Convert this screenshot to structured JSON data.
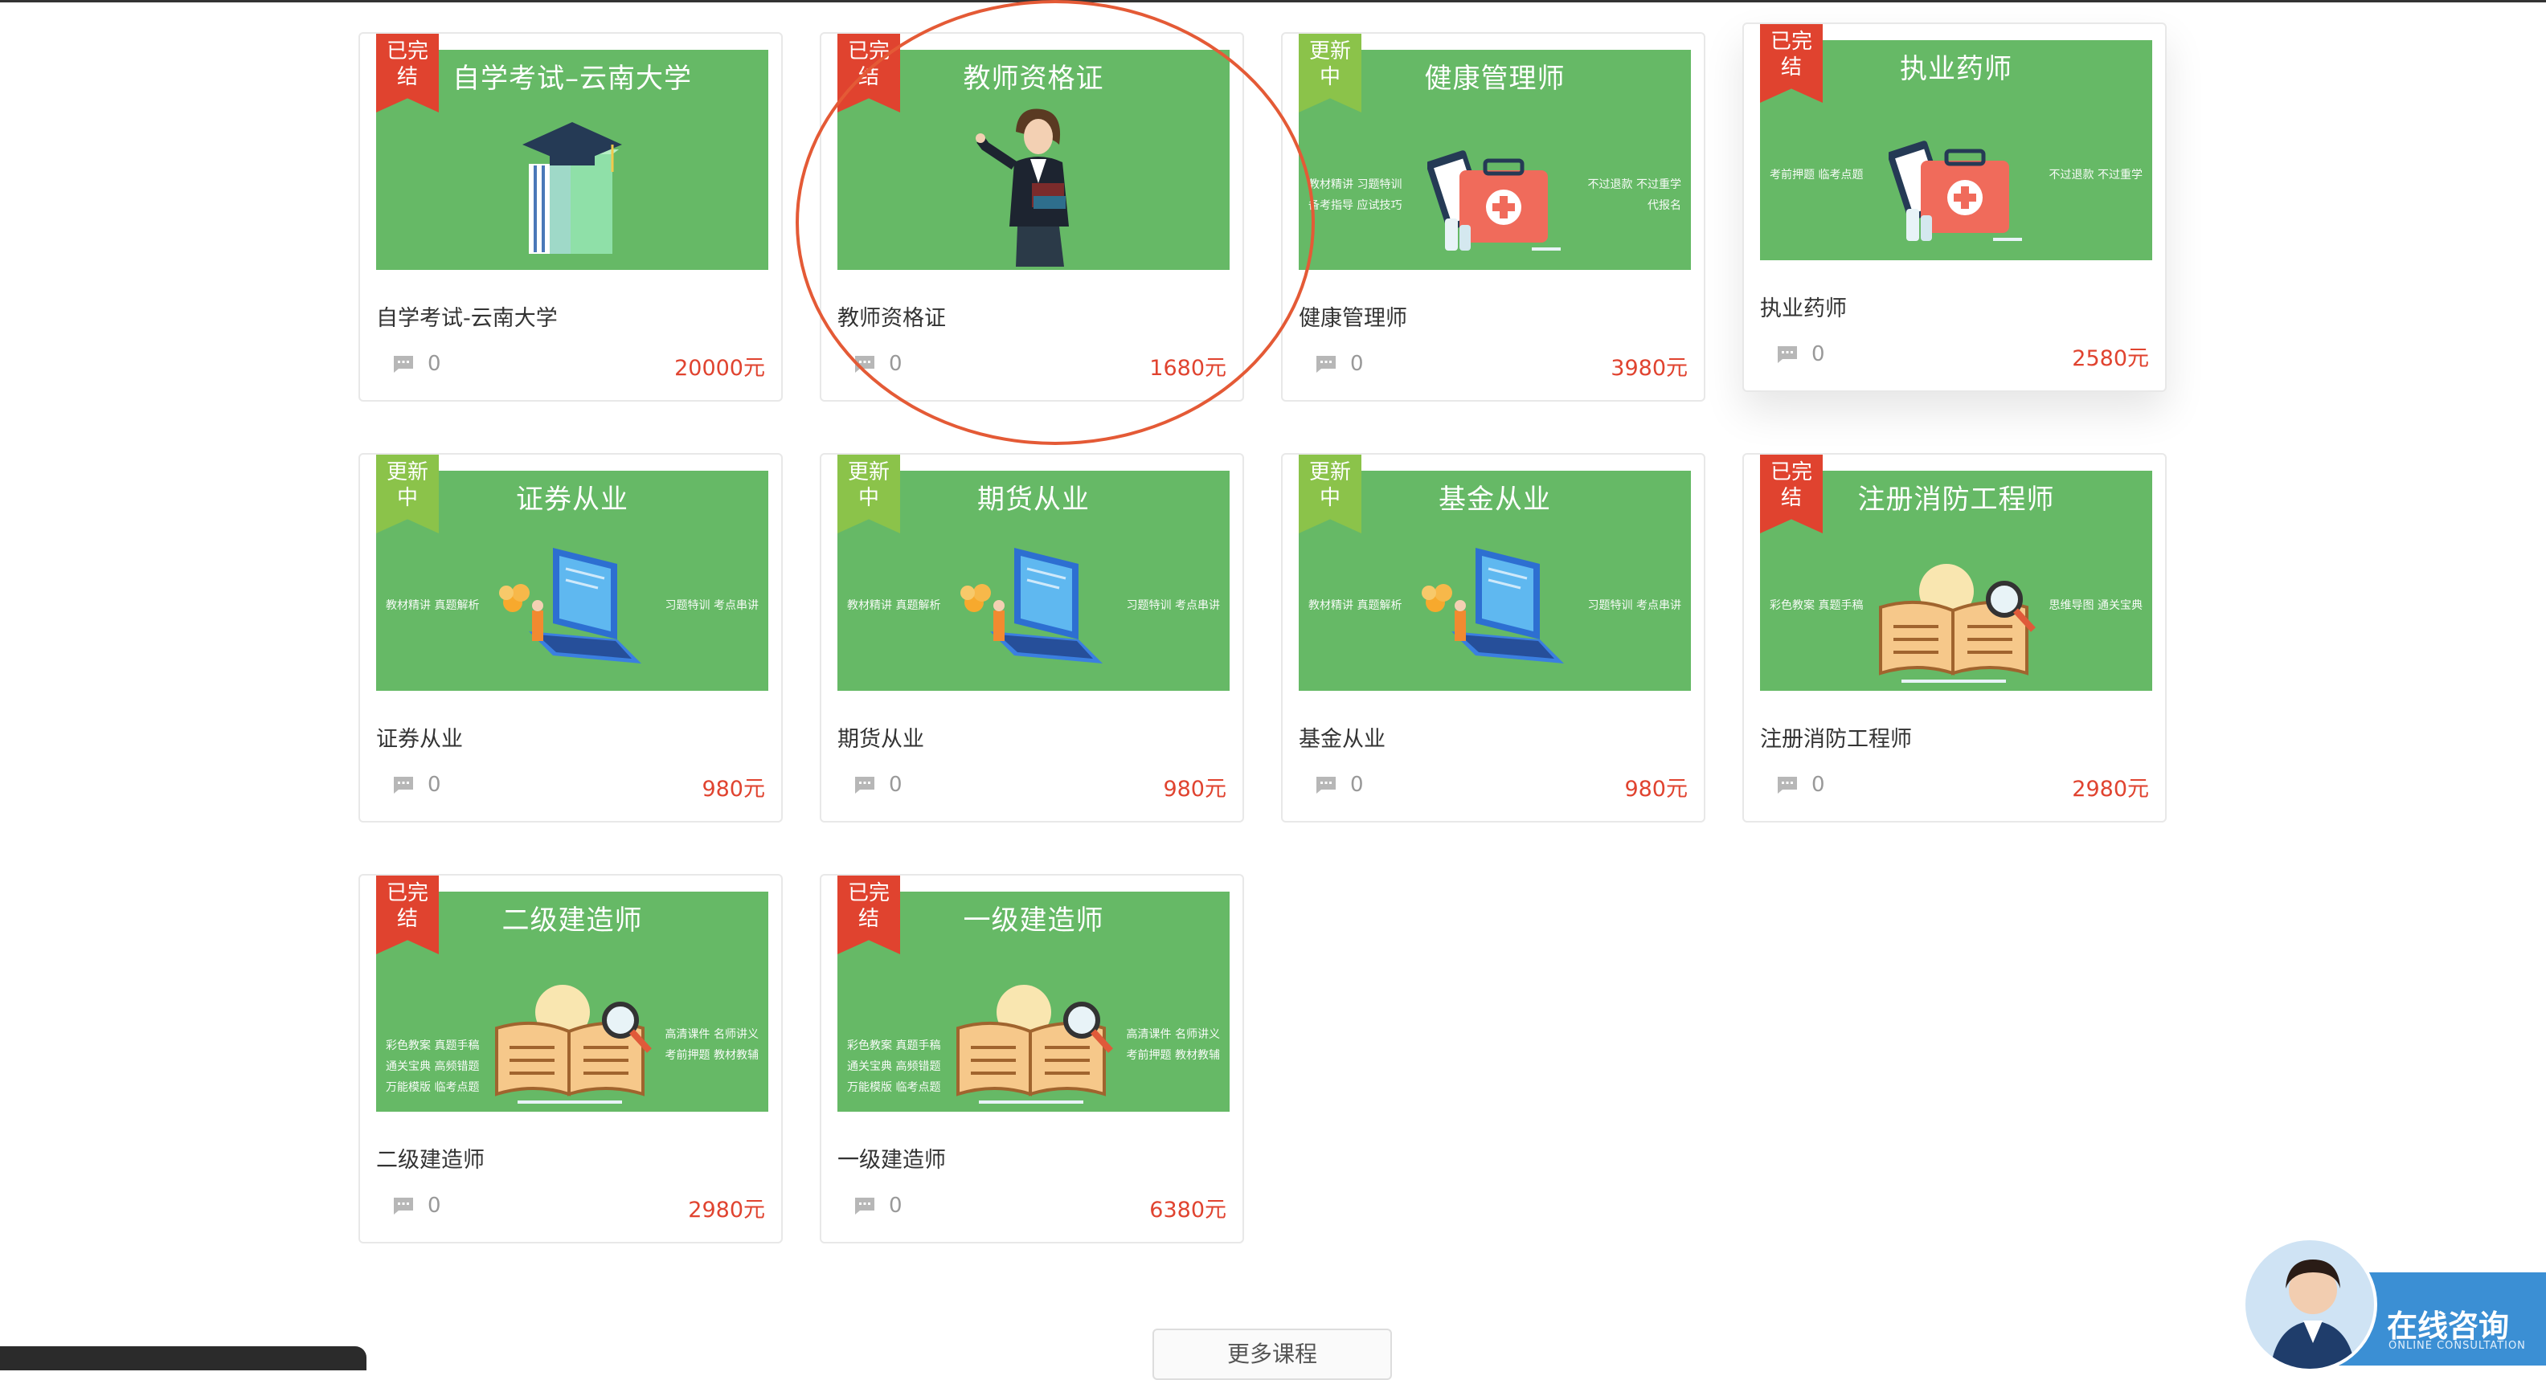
{
  "courses": [
    {
      "thumb_title": "自学考试–云南大学",
      "ribbon": "已完\n结",
      "ribbon_type": "done",
      "name": "自学考试-云南大学",
      "comments": "0",
      "price": "20000元",
      "illus": "books-cap",
      "feat_left": [],
      "feat_right": []
    },
    {
      "thumb_title": "教师资格证",
      "ribbon": "已完\n结",
      "ribbon_type": "done",
      "name": "教师资格证",
      "comments": "0",
      "price": "1680元",
      "illus": "teacher",
      "feat_left": [],
      "feat_right": []
    },
    {
      "thumb_title": "健康管理师",
      "ribbon": "更新\n中",
      "ribbon_type": "updating",
      "name": "健康管理师",
      "comments": "0",
      "price": "3980元",
      "illus": "medkit",
      "feat_left": [
        "教材精讲  习题特训",
        "备考指导  应试技巧"
      ],
      "feat_right": [
        "不过退款  不过重学",
        "代报名"
      ]
    },
    {
      "thumb_title": "执业药师",
      "ribbon": "已完\n结",
      "ribbon_type": "done",
      "name": "执业药师",
      "comments": "0",
      "price": "2580元",
      "illus": "medkit",
      "feat_left": [
        "考前押题  临考点题"
      ],
      "feat_right": [
        "不过退款  不过重学"
      ]
    },
    {
      "thumb_title": "证券从业",
      "ribbon": "更新\n中",
      "ribbon_type": "updating",
      "name": "证券从业",
      "comments": "0",
      "price": "980元",
      "illus": "laptop",
      "feat_left": [
        "教材精讲  真题解析"
      ],
      "feat_right": [
        "习题特训  考点串讲"
      ]
    },
    {
      "thumb_title": "期货从业",
      "ribbon": "更新\n中",
      "ribbon_type": "updating",
      "name": "期货从业",
      "comments": "0",
      "price": "980元",
      "illus": "laptop",
      "feat_left": [
        "教材精讲  真题解析"
      ],
      "feat_right": [
        "习题特训  考点串讲"
      ]
    },
    {
      "thumb_title": "基金从业",
      "ribbon": "更新\n中",
      "ribbon_type": "updating",
      "name": "基金从业",
      "comments": "0",
      "price": "980元",
      "illus": "laptop",
      "feat_left": [
        "教材精讲  真题解析"
      ],
      "feat_right": [
        "习题特训  考点串讲"
      ]
    },
    {
      "thumb_title": "注册消防工程师",
      "ribbon": "已完\n结",
      "ribbon_type": "done",
      "name": "注册消防工程师",
      "comments": "0",
      "price": "2980元",
      "illus": "book",
      "feat_left": [
        "彩色教案  真题手稿"
      ],
      "feat_right": [
        "思维导图  通关宝典"
      ]
    },
    {
      "thumb_title": "二级建造师",
      "ribbon": "已完\n结",
      "ribbon_type": "done",
      "name": "二级建造师",
      "comments": "0",
      "price": "2980元",
      "illus": "book",
      "feat_left": [
        "彩色教案  真题手稿",
        "通关宝典  高频错题",
        "万能模版  临考点题"
      ],
      "feat_right": [
        "高清课件  名师讲义",
        "考前押题  教材教辅"
      ]
    },
    {
      "thumb_title": "一级建造师",
      "ribbon": "已完\n结",
      "ribbon_type": "done",
      "name": "一级建造师",
      "comments": "0",
      "price": "6380元",
      "illus": "book",
      "feat_left": [
        "彩色教案  真题手稿",
        "通关宝典  高频错题",
        "万能模版  临考点题"
      ],
      "feat_right": [
        "高清课件  名师讲义",
        "考前押题  教材教辅"
      ]
    }
  ],
  "more_button": "更多课程",
  "consult": {
    "label": "在线咨询",
    "sub": "ONLINE CONSULTATION"
  },
  "colors": {
    "thumb_bg": "#66b966",
    "ribbon_done": "#e0432f",
    "ribbon_updating": "#8bc34a",
    "price": "#e0432f",
    "highlight": "#e45a36"
  }
}
